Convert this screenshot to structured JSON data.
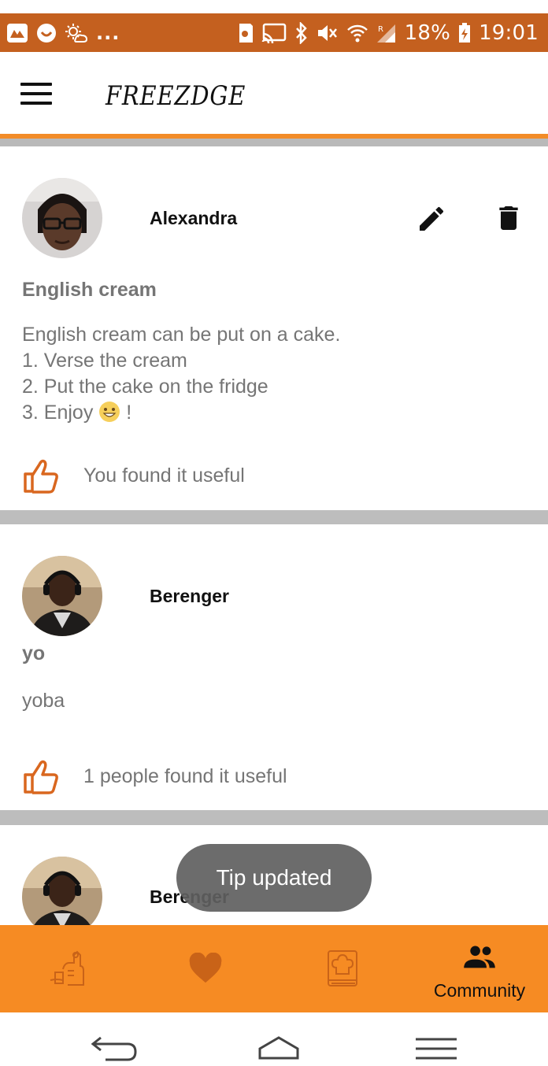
{
  "status_bar": {
    "dots": "...",
    "battery_percent": "18%",
    "time": "19:01",
    "background": "#c4601f"
  },
  "app_bar": {
    "title": "FREEZDGE",
    "accent": "#f28c28"
  },
  "tips": [
    {
      "author": "Alexandra",
      "title": "English cream",
      "body_lines": [
        "English cream can be put on a cake.",
        "1. Verse the cream",
        "2. Put the cake on the fridge",
        "3. Enjoy"
      ],
      "body_tail": " !",
      "useful_text": "You found it useful",
      "editable": true
    },
    {
      "author": "Berenger",
      "title": "yo",
      "body_lines": [
        "yoba"
      ],
      "useful_text": "1 people found it useful",
      "editable": false
    },
    {
      "author": "Berenger"
    }
  ],
  "toast": {
    "message": "Tip updated"
  },
  "bottom_nav": {
    "background": "#f68b23",
    "items": [
      {
        "icon": "fridge-food-icon",
        "label": ""
      },
      {
        "icon": "heart-icon",
        "label": ""
      },
      {
        "icon": "recipe-book-icon",
        "label": ""
      },
      {
        "icon": "community-icon",
        "label": "Community",
        "active": true
      }
    ]
  },
  "system_nav": {
    "buttons": [
      "back-icon",
      "home-icon",
      "menu-icon"
    ]
  }
}
